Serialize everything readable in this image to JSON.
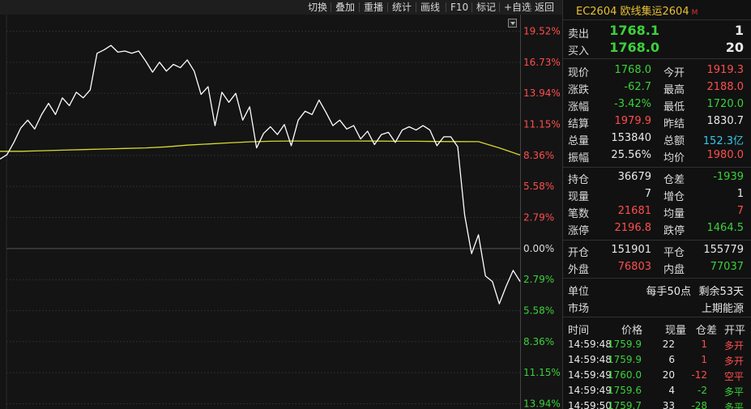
{
  "toolbar": [
    "切换",
    "叠加",
    "重播",
    "统计",
    "画线",
    "F10",
    "标记",
    "+自选",
    "返回"
  ],
  "chart": {
    "axis_labels": [
      {
        "text": "19.52%",
        "color": "red"
      },
      {
        "text": "16.73%",
        "color": "red"
      },
      {
        "text": "13.94%",
        "color": "red"
      },
      {
        "text": "11.15%",
        "color": "red"
      },
      {
        "text": "8.36%",
        "color": "red"
      },
      {
        "text": "5.58%",
        "color": "red"
      },
      {
        "text": "2.79%",
        "color": "red"
      },
      {
        "text": "0.00%",
        "color": "white"
      },
      {
        "text": "2.79%",
        "color": "green"
      },
      {
        "text": "5.58%",
        "color": "green"
      },
      {
        "text": "8.36%",
        "color": "green"
      },
      {
        "text": "11.15%",
        "color": "green"
      },
      {
        "text": "13.94%",
        "color": "green"
      }
    ],
    "price_line_color": "#ffffff",
    "avg_line_color": "#d8d830"
  },
  "chart_data": {
    "type": "line",
    "y_unit": "% change vs previous settlement (1830.7)",
    "ylim": [
      -13.94,
      19.52
    ],
    "y_ticks": [
      19.52,
      16.73,
      13.94,
      11.15,
      8.36,
      5.58,
      2.79,
      0.0,
      -2.79,
      -5.58,
      -8.36,
      -11.15,
      -13.94
    ],
    "series": [
      {
        "name": "price",
        "values": [
          8.0,
          8.4,
          9.5,
          10.8,
          11.5,
          10.7,
          12.0,
          13.0,
          12.0,
          13.5,
          12.8,
          14.0,
          13.5,
          14.2,
          17.5,
          17.8,
          18.2,
          17.6,
          17.7,
          17.5,
          17.7,
          16.8,
          15.8,
          16.7,
          15.9,
          16.5,
          16.2,
          16.9,
          15.9,
          13.8,
          14.5,
          11.0,
          14.0,
          13.1,
          13.9,
          11.5,
          12.7,
          9.0,
          10.3,
          10.9,
          10.2,
          11.1,
          9.2,
          11.5,
          12.3,
          12.0,
          13.3,
          12.2,
          11.0,
          11.5,
          10.7,
          11.0,
          9.8,
          10.5,
          9.3,
          10.2,
          10.4,
          9.5,
          10.6,
          10.9,
          10.6,
          11.0,
          10.6,
          9.2,
          10.0,
          10.0,
          9.1,
          3.0,
          -0.5,
          1.2,
          -2.5,
          -3.0,
          -5.0,
          -3.4,
          -2.0,
          -3.0
        ]
      },
      {
        "name": "average",
        "values": [
          8.7,
          8.7,
          8.75,
          8.8,
          8.85,
          8.9,
          8.95,
          9.0,
          9.1,
          9.25,
          9.35,
          9.45,
          9.55,
          9.6,
          9.62,
          9.62,
          9.62,
          9.62,
          9.61,
          9.6,
          9.6,
          9.58,
          9.57,
          9.56,
          9.0,
          8.36
        ]
      }
    ]
  },
  "quote": {
    "header": "EC2604 欧线集运2604",
    "market_badge": "M",
    "sell": {
      "label": "卖出",
      "price": "1768.1",
      "vol": "1"
    },
    "buy": {
      "label": "买入",
      "price": "1768.0",
      "vol": "20"
    },
    "rows_a": [
      {
        "l1": "现价",
        "v1": "1768.0",
        "c1": "green",
        "l2": "今开",
        "v2": "1919.3",
        "c2": "red"
      },
      {
        "l1": "涨跌",
        "v1": "-62.7",
        "c1": "green",
        "l2": "最高",
        "v2": "2188.0",
        "c2": "red"
      },
      {
        "l1": "涨幅",
        "v1": "-3.42%",
        "c1": "green",
        "l2": "最低",
        "v2": "1720.0",
        "c2": "green"
      },
      {
        "l1": "结算",
        "v1": "1979.9",
        "c1": "red",
        "l2": "昨结",
        "v2": "1830.7",
        "c2": "white"
      },
      {
        "l1": "总量",
        "v1": "153840",
        "c1": "white",
        "l2": "总额",
        "v2": "152.3亿",
        "c2": "cyan"
      },
      {
        "l1": "振幅",
        "v1": "25.56%",
        "c1": "white",
        "l2": "均价",
        "v2": "1980.0",
        "c2": "red"
      }
    ],
    "rows_b": [
      {
        "l1": "持仓",
        "v1": "36679",
        "c1": "white",
        "l2": "仓差",
        "v2": "-1939",
        "c2": "green"
      },
      {
        "l1": "现量",
        "v1": "7",
        "c1": "white",
        "l2": "增仓",
        "v2": "1",
        "c2": "white"
      },
      {
        "l1": "笔数",
        "v1": "21681",
        "c1": "red",
        "l2": "均量",
        "v2": "7",
        "c2": "red"
      },
      {
        "l1": "涨停",
        "v1": "2196.8",
        "c1": "red",
        "l2": "跌停",
        "v2": "1464.5",
        "c2": "green"
      }
    ],
    "rows_c": [
      {
        "l1": "开仓",
        "v1": "151901",
        "c1": "white",
        "l2": "平仓",
        "v2": "155779",
        "c2": "white"
      },
      {
        "l1": "外盘",
        "v1": "76803",
        "c1": "red",
        "l2": "内盘",
        "v2": "77037",
        "c2": "green"
      }
    ],
    "unit_label": "单位",
    "unit_value": "每手50点",
    "remaining": "剩余53天",
    "market_label": "市场",
    "market_value": "上期能源"
  },
  "trades": {
    "headers": [
      "时间",
      "价格",
      "现量",
      "仓差",
      "开平"
    ],
    "rows": [
      {
        "time": "14:59:48",
        "price": "1759.9",
        "vol": "22",
        "diff": "1",
        "diff_color": "red",
        "type": "多开",
        "type_color": "red"
      },
      {
        "time": "14:59:48",
        "price": "1759.9",
        "vol": "6",
        "diff": "1",
        "diff_color": "red",
        "type": "多开",
        "type_color": "red"
      },
      {
        "time": "14:59:49",
        "price": "1760.0",
        "vol": "20",
        "diff": "-12",
        "diff_color": "red",
        "type": "空平",
        "type_color": "red"
      },
      {
        "time": "14:59:49",
        "price": "1759.6",
        "vol": "4",
        "diff": "-2",
        "diff_color": "green",
        "type": "多平",
        "type_color": "green"
      },
      {
        "time": "14:59:50",
        "price": "1759.7",
        "vol": "33",
        "diff": "-28",
        "diff_color": "green",
        "type": "多平",
        "type_color": "green"
      }
    ]
  }
}
